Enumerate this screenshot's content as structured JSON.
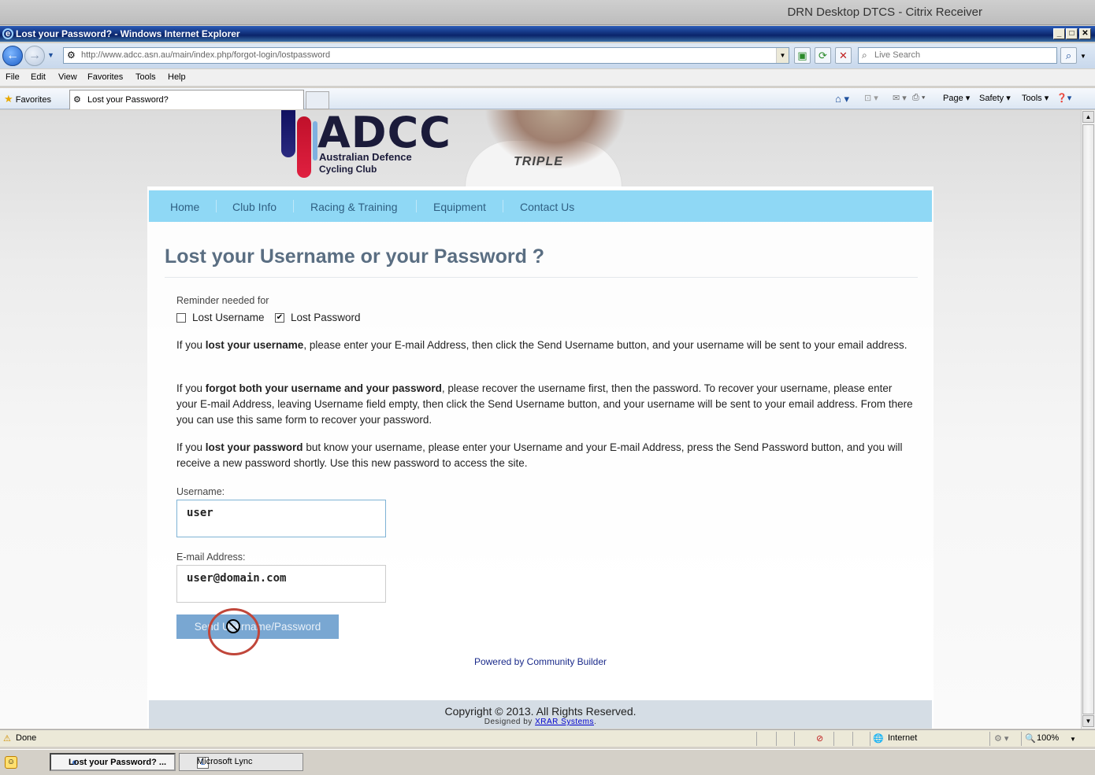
{
  "citrix": {
    "title": "DRN Desktop DTCS - Citrix Receiver"
  },
  "window": {
    "title": "Lost your Password? - Windows Internet Explorer"
  },
  "address": {
    "url": "http://www.adcc.asn.au/main/index.php/forgot-login/lostpassword"
  },
  "search": {
    "placeholder": "Live Search"
  },
  "menu": [
    "File",
    "Edit",
    "View",
    "Favorites",
    "Tools",
    "Help"
  ],
  "favbar": {
    "favorites": "Favorites",
    "tab_title": "Lost your Password?",
    "commands": [
      "Page",
      "Safety",
      "Tools"
    ]
  },
  "logo": {
    "letters": "ADCC",
    "line1": "Australian Defence",
    "line2": "Cycling Club"
  },
  "header_photo": {
    "jersey_text": "TRIPLE"
  },
  "nav": [
    "Home",
    "Club Info",
    "Racing & Training",
    "Equipment",
    "Contact Us"
  ],
  "page": {
    "heading": "Lost your Username or your Password ?",
    "reminder_label": "Reminder needed for",
    "lost_username": "Lost Username",
    "lost_password": "Lost Password",
    "lost_username_checked": false,
    "lost_password_checked": true,
    "para1_pre": "If you ",
    "para1_bold": "lost your username",
    "para1_post": ", please enter your E-mail Address, then click the Send Username button, and your username will be sent to your email address.",
    "para2_pre": "If you ",
    "para2_bold": "forgot both your username and your password",
    "para2_post": ", please recover the username first, then the password. To recover your username, please enter your E-mail Address, leaving Username field empty, then click the Send Username button, and your username will be sent to your email address. From there you can use this same form to recover your password.",
    "para3_pre": "If you ",
    "para3_bold": "lost your password",
    "para3_post": " but know your username, please enter your Username and your E-mail Address, press the Send Password button, and you will receive a new password shortly. Use this new password to access the site.",
    "username_label": "Username:",
    "username_value": "user",
    "email_label": "E-mail Address:",
    "email_value": "user@domain.com",
    "send_button": "Send Username/Password",
    "powered": "Powered by Community Builder",
    "copyright": "Copyright © 2013. All Rights Reserved.",
    "designed_pre": "Designed by ",
    "designed_link": "XRAR Systems",
    "designed_post": "."
  },
  "status": {
    "text": "Done",
    "zone": "Internet",
    "zoom": "100%"
  },
  "taskbar": {
    "items": [
      "Lost your Password? ...",
      "Microsoft Lync"
    ]
  },
  "colors": {
    "nav_bg": "#8fd8f5",
    "heading": "#5a6e82",
    "button": "#79a7d2",
    "footer": "#d5dde5",
    "cursor_ring": "#c0463a"
  }
}
